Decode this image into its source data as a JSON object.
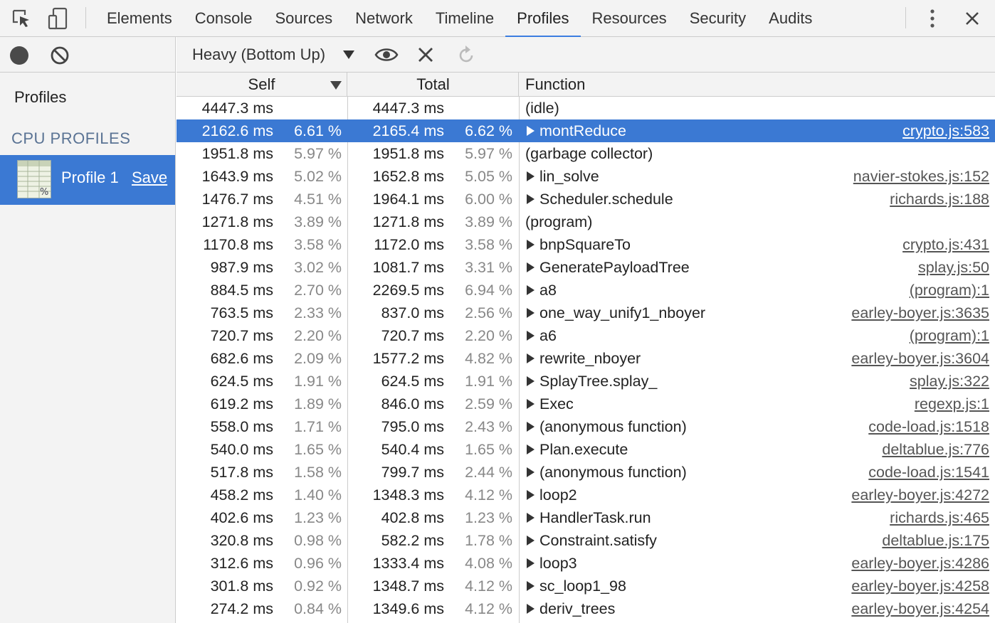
{
  "topbar": {
    "tabs": [
      {
        "label": "Elements"
      },
      {
        "label": "Console"
      },
      {
        "label": "Sources"
      },
      {
        "label": "Network"
      },
      {
        "label": "Timeline"
      },
      {
        "label": "Profiles",
        "active": true
      },
      {
        "label": "Resources"
      },
      {
        "label": "Security"
      },
      {
        "label": "Audits"
      }
    ],
    "accent": "#3b7de0"
  },
  "sidebar": {
    "title": "Profiles",
    "section": "CPU PROFILES",
    "profile": {
      "name": "Profile 1",
      "save_label": "Save"
    },
    "selected_bg": "#3b79d3"
  },
  "toolbar": {
    "view": "Heavy (Bottom Up)"
  },
  "table": {
    "headers": {
      "self": "Self",
      "total": "Total",
      "function": "Function"
    },
    "rows": [
      {
        "self": "4447.3 ms",
        "self_pct": "",
        "total": "4447.3 ms",
        "total_pct": "",
        "func": "(idle)",
        "expandable": false,
        "url": ""
      },
      {
        "self": "2162.6 ms",
        "self_pct": "6.61 %",
        "total": "2165.4 ms",
        "total_pct": "6.62 %",
        "func": "montReduce",
        "expandable": true,
        "url": "crypto.js:583",
        "selected": true
      },
      {
        "self": "1951.8 ms",
        "self_pct": "5.97 %",
        "total": "1951.8 ms",
        "total_pct": "5.97 %",
        "func": "(garbage collector)",
        "expandable": false,
        "url": ""
      },
      {
        "self": "1643.9 ms",
        "self_pct": "5.02 %",
        "total": "1652.8 ms",
        "total_pct": "5.05 %",
        "func": "lin_solve",
        "expandable": true,
        "url": "navier-stokes.js:152"
      },
      {
        "self": "1476.7 ms",
        "self_pct": "4.51 %",
        "total": "1964.1 ms",
        "total_pct": "6.00 %",
        "func": "Scheduler.schedule",
        "expandable": true,
        "url": "richards.js:188"
      },
      {
        "self": "1271.8 ms",
        "self_pct": "3.89 %",
        "total": "1271.8 ms",
        "total_pct": "3.89 %",
        "func": "(program)",
        "expandable": false,
        "url": ""
      },
      {
        "self": "1170.8 ms",
        "self_pct": "3.58 %",
        "total": "1172.0 ms",
        "total_pct": "3.58 %",
        "func": "bnpSquareTo",
        "expandable": true,
        "url": "crypto.js:431"
      },
      {
        "self": "987.9 ms",
        "self_pct": "3.02 %",
        "total": "1081.7 ms",
        "total_pct": "3.31 %",
        "func": "GeneratePayloadTree",
        "expandable": true,
        "url": "splay.js:50"
      },
      {
        "self": "884.5 ms",
        "self_pct": "2.70 %",
        "total": "2269.5 ms",
        "total_pct": "6.94 %",
        "func": "a8",
        "expandable": true,
        "url": "(program):1"
      },
      {
        "self": "763.5 ms",
        "self_pct": "2.33 %",
        "total": "837.0 ms",
        "total_pct": "2.56 %",
        "func": "one_way_unify1_nboyer",
        "expandable": true,
        "url": "earley-boyer.js:3635"
      },
      {
        "self": "720.7 ms",
        "self_pct": "2.20 %",
        "total": "720.7 ms",
        "total_pct": "2.20 %",
        "func": "a6",
        "expandable": true,
        "url": "(program):1"
      },
      {
        "self": "682.6 ms",
        "self_pct": "2.09 %",
        "total": "1577.2 ms",
        "total_pct": "4.82 %",
        "func": "rewrite_nboyer",
        "expandable": true,
        "url": "earley-boyer.js:3604"
      },
      {
        "self": "624.5 ms",
        "self_pct": "1.91 %",
        "total": "624.5 ms",
        "total_pct": "1.91 %",
        "func": "SplayTree.splay_",
        "expandable": true,
        "url": "splay.js:322"
      },
      {
        "self": "619.2 ms",
        "self_pct": "1.89 %",
        "total": "846.0 ms",
        "total_pct": "2.59 %",
        "func": "Exec",
        "expandable": true,
        "url": "regexp.js:1"
      },
      {
        "self": "558.0 ms",
        "self_pct": "1.71 %",
        "total": "795.0 ms",
        "total_pct": "2.43 %",
        "func": "(anonymous function)",
        "expandable": true,
        "url": "code-load.js:1518"
      },
      {
        "self": "540.0 ms",
        "self_pct": "1.65 %",
        "total": "540.4 ms",
        "total_pct": "1.65 %",
        "func": "Plan.execute",
        "expandable": true,
        "url": "deltablue.js:776"
      },
      {
        "self": "517.8 ms",
        "self_pct": "1.58 %",
        "total": "799.7 ms",
        "total_pct": "2.44 %",
        "func": "(anonymous function)",
        "expandable": true,
        "url": "code-load.js:1541"
      },
      {
        "self": "458.2 ms",
        "self_pct": "1.40 %",
        "total": "1348.3 ms",
        "total_pct": "4.12 %",
        "func": "loop2",
        "expandable": true,
        "url": "earley-boyer.js:4272"
      },
      {
        "self": "402.6 ms",
        "self_pct": "1.23 %",
        "total": "402.8 ms",
        "total_pct": "1.23 %",
        "func": "HandlerTask.run",
        "expandable": true,
        "url": "richards.js:465"
      },
      {
        "self": "320.8 ms",
        "self_pct": "0.98 %",
        "total": "582.2 ms",
        "total_pct": "1.78 %",
        "func": "Constraint.satisfy",
        "expandable": true,
        "url": "deltablue.js:175"
      },
      {
        "self": "312.6 ms",
        "self_pct": "0.96 %",
        "total": "1333.4 ms",
        "total_pct": "4.08 %",
        "func": "loop3",
        "expandable": true,
        "url": "earley-boyer.js:4286"
      },
      {
        "self": "301.8 ms",
        "self_pct": "0.92 %",
        "total": "1348.7 ms",
        "total_pct": "4.12 %",
        "func": "sc_loop1_98",
        "expandable": true,
        "url": "earley-boyer.js:4258"
      },
      {
        "self": "274.2 ms",
        "self_pct": "0.84 %",
        "total": "1349.6 ms",
        "total_pct": "4.12 %",
        "func": "deriv_trees",
        "expandable": true,
        "url": "earley-boyer.js:4254"
      }
    ],
    "selected_bg": "#3b79d3"
  }
}
